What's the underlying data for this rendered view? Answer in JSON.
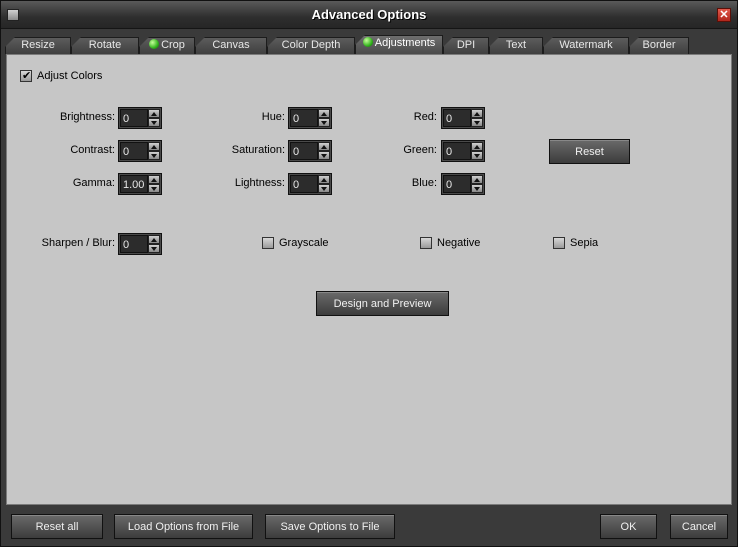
{
  "window": {
    "title": "Advanced Options"
  },
  "tabs": [
    {
      "label": "Resize",
      "dot": false
    },
    {
      "label": "Rotate",
      "dot": false
    },
    {
      "label": "Crop",
      "dot": true
    },
    {
      "label": "Canvas",
      "dot": false
    },
    {
      "label": "Color Depth",
      "dot": false
    },
    {
      "label": "Adjustments",
      "dot": true,
      "active": true
    },
    {
      "label": "DPI",
      "dot": false
    },
    {
      "label": "Text",
      "dot": false
    },
    {
      "label": "Watermark",
      "dot": false
    },
    {
      "label": "Border",
      "dot": false
    }
  ],
  "panel": {
    "adjust_colors": {
      "label": "Adjust Colors",
      "checked": true
    },
    "fields": {
      "brightness": {
        "label": "Brightness:",
        "value": "0"
      },
      "contrast": {
        "label": "Contrast:",
        "value": "0"
      },
      "gamma": {
        "label": "Gamma:",
        "value": "1.00"
      },
      "hue": {
        "label": "Hue:",
        "value": "0"
      },
      "saturation": {
        "label": "Saturation:",
        "value": "0"
      },
      "lightness": {
        "label": "Lightness:",
        "value": "0"
      },
      "red": {
        "label": "Red:",
        "value": "0"
      },
      "green": {
        "label": "Green:",
        "value": "0"
      },
      "blue": {
        "label": "Blue:",
        "value": "0"
      },
      "sharpen": {
        "label": "Sharpen / Blur:",
        "value": "0"
      }
    },
    "reset_label": "Reset",
    "grayscale": {
      "label": "Grayscale",
      "checked": false
    },
    "negative": {
      "label": "Negative",
      "checked": false
    },
    "sepia": {
      "label": "Sepia",
      "checked": false
    },
    "design_preview_label": "Design and Preview"
  },
  "footer": {
    "reset_all": "Reset all",
    "load_options": "Load Options from File",
    "save_options": "Save Options to File",
    "ok": "OK",
    "cancel": "Cancel"
  }
}
